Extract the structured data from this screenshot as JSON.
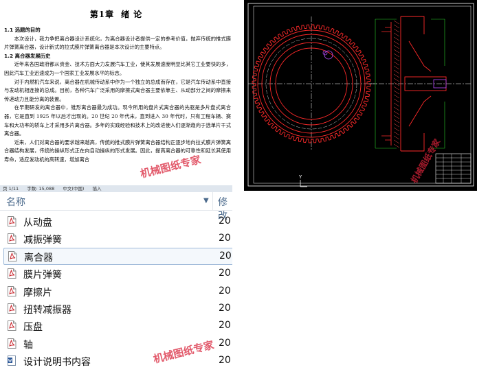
{
  "document": {
    "chapter_label": "第1章",
    "chapter_title": "绪  论",
    "section1_heading": "1.1 选题的目的",
    "section1_para": "本次设计，我力争把离合器设计系统化，为离合器设计者提供一定的参考价值，抛弃传统的推式膜片弹簧离合器，设计新式的拉式膜片弹簧离合器是本次设计的主要特点。",
    "section2_heading": "1.2 离合器发展历史",
    "para2": "近年来各国政府都从资金、技术方面大力发展汽车工业，使其发展速度明显比其它工业要快的多，因此汽车工业迅速成为一个国家工业发展水平的标志。",
    "para3": "对于内燃机汽车来说，离合器在机械传动系中作为一个独立的总成而存在，它是汽车传动系中直接与发动机相连接的总成。目前，各种汽车广泛采用的摩擦式离合器主要依靠主、从动部分之间的摩擦来传递动力且能分离的装置。",
    "para4": "在早期研发的离合器中，锥形离合器最为成功。现今所用的盘片式离合器的先驱是多片盘式离合器，它是直到 1925 年以后才出现的。20 世纪 20 年代末，直到进入 30 年代时，只有工程车辆、赛车和大功率的轿车上才采用多片离合器。多年的实践经验和技术上的改进使人们逐渐趋向于选单片干式离合器。",
    "para5": "近来，人们对离合器的要求越来越高，传统的推式膜片弹簧离合器结构正逐步地向拉式膜片弹簧离合器结构发展，传统的操纵形式正在向自动操纵的形式发展。因此，提高离合器的可靠性和延长其使用寿命，适应发动机的高转速，增加离合"
  },
  "watermarks": {
    "doc": "机械图纸专家",
    "cad": "机械图纸专家",
    "explorer": "机械图纸专家"
  },
  "status_bar": {
    "page": "页 1/11",
    "words": "字数: 15,088",
    "language": "中文(中国)",
    "mode": "插入"
  },
  "explorer": {
    "col_name": "名称",
    "col_modified": "修改",
    "files": [
      {
        "name": "从动盘",
        "modified": "20",
        "selected": false,
        "icon": "pdf-file-icon"
      },
      {
        "name": "减振弹簧",
        "modified": "20",
        "selected": false,
        "icon": "pdf-file-icon"
      },
      {
        "name": "离合器",
        "modified": "20",
        "selected": true,
        "icon": "pdf-file-icon"
      },
      {
        "name": "膜片弹簧",
        "modified": "20",
        "selected": false,
        "icon": "pdf-file-icon"
      },
      {
        "name": "摩擦片",
        "modified": "20",
        "selected": false,
        "icon": "pdf-file-icon"
      },
      {
        "name": "扭转减振器",
        "modified": "20",
        "selected": false,
        "icon": "pdf-file-icon"
      },
      {
        "name": "压盘",
        "modified": "20",
        "selected": false,
        "icon": "pdf-file-icon"
      },
      {
        "name": "轴",
        "modified": "20",
        "selected": false,
        "icon": "pdf-file-icon"
      },
      {
        "name": "设计说明书内容",
        "modified": "20",
        "selected": false,
        "icon": "word-file-icon"
      }
    ]
  },
  "cad": {
    "axis_label": "Y",
    "colors": {
      "background": "#000000",
      "outline": "#ff2a2a",
      "centerline": "#ffffff",
      "section": "#2bd12b",
      "frame": "#ffffff"
    }
  }
}
